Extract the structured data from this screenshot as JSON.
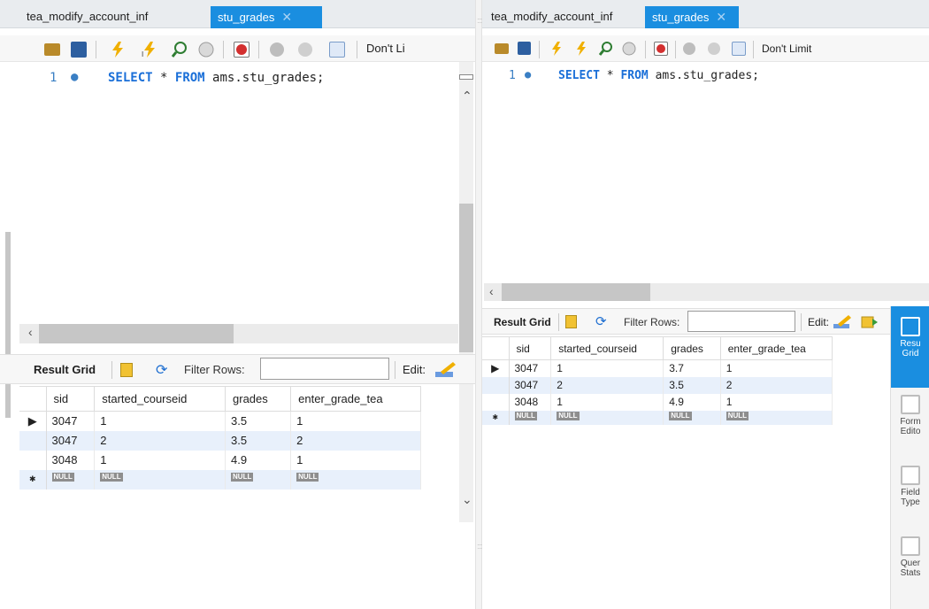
{
  "left": {
    "tabs": [
      {
        "label": "tea_modify_account_inf",
        "active": false
      },
      {
        "label": "stu_grades",
        "active": true
      }
    ],
    "toolbar": {
      "limit_label": "Don't Li"
    },
    "editor": {
      "line_number": "1",
      "kw1": "SELECT",
      "star": "*",
      "kw2": "FROM",
      "rest": "ams.stu_grades;"
    },
    "results": {
      "title": "Result Grid",
      "filter_label": "Filter Rows:",
      "filter_value": "",
      "edit_label": "Edit:",
      "columns": [
        "sid",
        "started_courseid",
        "grades",
        "enter_grade_tea"
      ],
      "rows": [
        [
          "3047",
          "1",
          "3.5",
          "1"
        ],
        [
          "3047",
          "2",
          "3.5",
          "2"
        ],
        [
          "3048",
          "1",
          "4.9",
          "1"
        ]
      ],
      "null_label": "NULL"
    }
  },
  "right": {
    "tabs": [
      {
        "label": "tea_modify_account_inf",
        "active": false
      },
      {
        "label": "stu_grades",
        "active": true
      }
    ],
    "toolbar": {
      "limit_label": "Don't Limit"
    },
    "editor": {
      "line_number": "1",
      "kw1": "SELECT",
      "star": "*",
      "kw2": "FROM",
      "rest": "ams.stu_grades;"
    },
    "results": {
      "title": "Result Grid",
      "filter_label": "Filter Rows:",
      "filter_value": "",
      "edit_label": "Edit:",
      "columns": [
        "sid",
        "started_courseid",
        "grades",
        "enter_grade_tea"
      ],
      "rows": [
        [
          "3047",
          "1",
          "3.7",
          "1"
        ],
        [
          "3047",
          "2",
          "3.5",
          "2"
        ],
        [
          "3048",
          "1",
          "4.9",
          "1"
        ]
      ],
      "null_label": "NULL"
    },
    "side_panel": [
      {
        "label": "Resu Grid",
        "active": true
      },
      {
        "label": "Form Edito",
        "active": false
      },
      {
        "label": "Field Type",
        "active": false
      },
      {
        "label": "Quer Stats",
        "active": false
      }
    ]
  },
  "colors": {
    "accent": "#1a8ee0",
    "keyword": "#1a6fd8",
    "alt_row": "#e8f0fb"
  }
}
